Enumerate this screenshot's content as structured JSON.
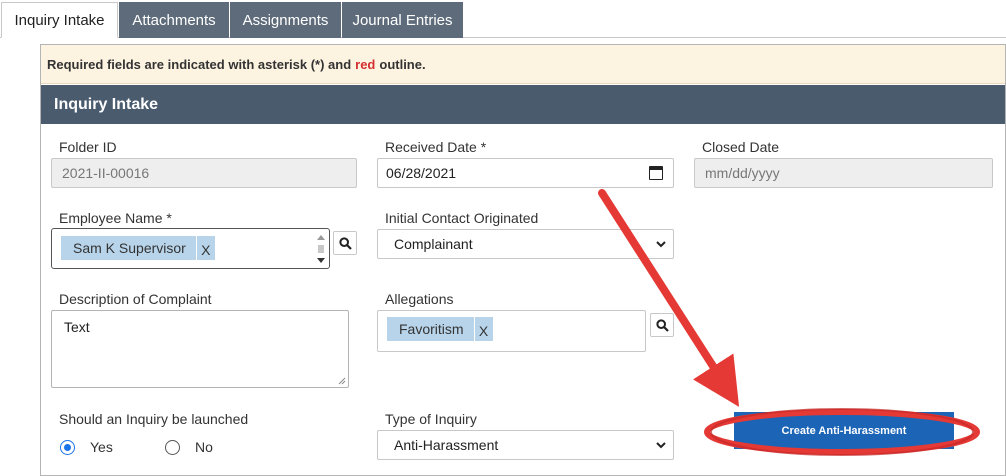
{
  "tabs": [
    {
      "label": "Inquiry Intake",
      "active": true
    },
    {
      "label": "Attachments",
      "active": false
    },
    {
      "label": "Assignments",
      "active": false
    },
    {
      "label": "Journal Entries",
      "active": false
    }
  ],
  "notice": {
    "prefix": "Required fields are indicated with asterisk (*) and ",
    "highlight": "red",
    "suffix": " outline."
  },
  "section": {
    "title": "Inquiry Intake"
  },
  "fields": {
    "folder_id": {
      "label": "Folder ID",
      "value": "2021-II-00016"
    },
    "received_date": {
      "label": "Received Date *",
      "value": "06/28/2021"
    },
    "closed_date": {
      "label": "Closed Date",
      "placeholder": "mm/dd/yyyy"
    },
    "employee_name": {
      "label": "Employee Name *",
      "tag": "Sam K Supervisor",
      "remove": "X"
    },
    "initial_contact": {
      "label": "Initial Contact Originated",
      "selected": "Complainant"
    },
    "description": {
      "label": "Description of Complaint",
      "value": "Text"
    },
    "allegations": {
      "label": "Allegations",
      "tag": "Favoritism",
      "remove": "X"
    },
    "launch_inquiry": {
      "label": "Should an Inquiry be launched",
      "yes": "Yes",
      "no": "No",
      "selected": "Yes"
    },
    "type_of_inquiry": {
      "label": "Type of Inquiry",
      "selected": "Anti-Harassment"
    }
  },
  "actions": {
    "create": "Create Anti-Harassment"
  },
  "colors": {
    "tab_bg": "#5e6b7a",
    "header_bg": "#4a5b6e",
    "notice_bg": "#fdf3e1",
    "tag_bg": "#b8d4ea",
    "button_bg": "#1b64b6",
    "annotation_red": "#e53935"
  },
  "icons": [
    "search-icon",
    "calendar-icon",
    "chevron-down-icon",
    "spinner-icon",
    "resize-grip-icon"
  ]
}
